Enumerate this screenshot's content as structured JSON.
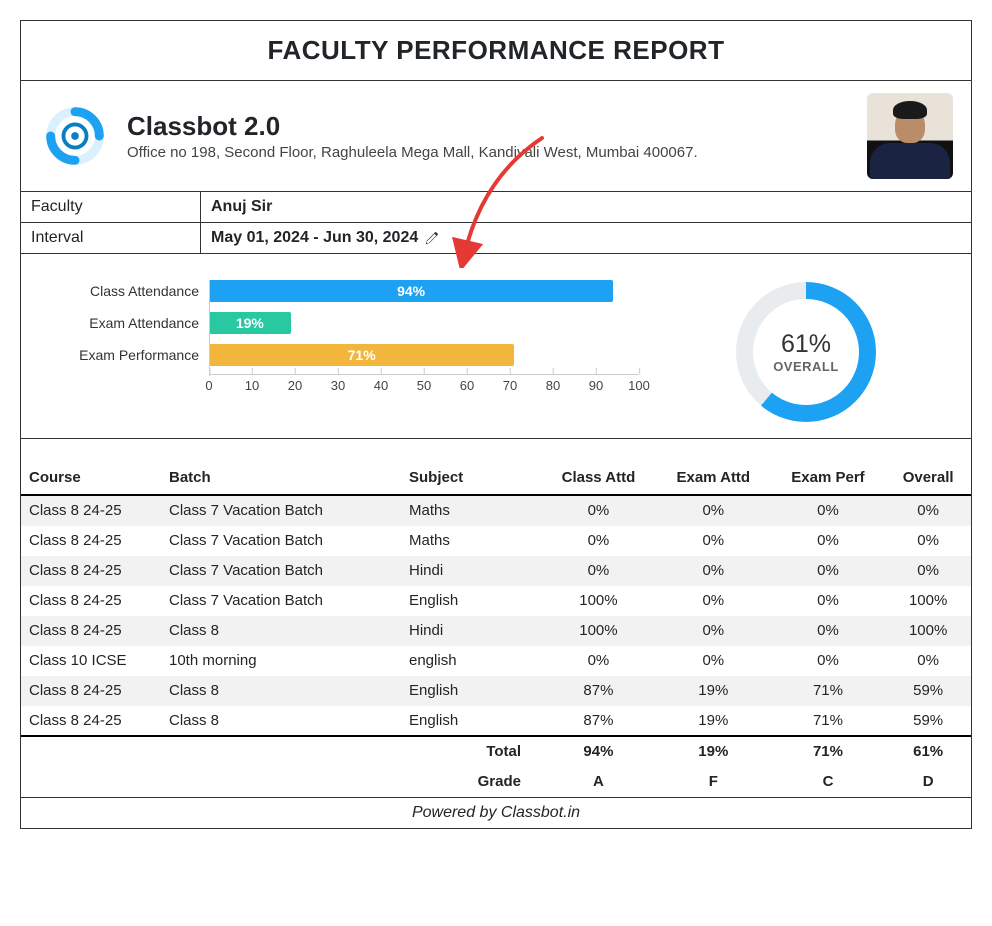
{
  "title": "FACULTY PERFORMANCE REPORT",
  "brand": {
    "name": "Classbot 2.0",
    "address": "Office no 198, Second Floor, Raghuleela Mega Mall, Kandivali West, Mumbai 400067."
  },
  "info": {
    "faculty_label": "Faculty",
    "faculty_value": "Anuj Sir",
    "interval_label": "Interval",
    "interval_value": "May 01, 2024 - Jun 30, 2024"
  },
  "chart_data": {
    "type": "bar",
    "orientation": "horizontal",
    "categories": [
      "Class Attendance",
      "Exam Attendance",
      "Exam Performance"
    ],
    "values": [
      94,
      19,
      71
    ],
    "value_labels": [
      "94%",
      "19%",
      "71%"
    ],
    "colors": [
      "#1da1f2",
      "#28c9a1",
      "#f2b63c"
    ],
    "xlim": [
      0,
      100
    ],
    "ticks": [
      0,
      10,
      20,
      30,
      40,
      50,
      60,
      70,
      80,
      90,
      100
    ],
    "donut": {
      "value": 61,
      "value_label": "61%",
      "label": "OVERALL",
      "fill_color": "#1da1f2",
      "track_color": "#e9ecef"
    }
  },
  "table": {
    "headers": {
      "course": "Course",
      "batch": "Batch",
      "subject": "Subject",
      "class_attd": "Class Attd",
      "exam_attd": "Exam Attd",
      "exam_perf": "Exam Perf",
      "overall": "Overall"
    },
    "rows": [
      {
        "course": "Class 8 24-25",
        "batch": "Class 7 Vacation Batch",
        "subject": "Maths",
        "class_attd": "0%",
        "exam_attd": "0%",
        "exam_perf": "0%",
        "overall": "0%"
      },
      {
        "course": "Class 8 24-25",
        "batch": "Class 7 Vacation Batch",
        "subject": "Maths",
        "class_attd": "0%",
        "exam_attd": "0%",
        "exam_perf": "0%",
        "overall": "0%"
      },
      {
        "course": "Class 8 24-25",
        "batch": "Class 7 Vacation Batch",
        "subject": "Hindi",
        "class_attd": "0%",
        "exam_attd": "0%",
        "exam_perf": "0%",
        "overall": "0%"
      },
      {
        "course": "Class 8 24-25",
        "batch": "Class 7 Vacation Batch",
        "subject": "English",
        "class_attd": "100%",
        "exam_attd": "0%",
        "exam_perf": "0%",
        "overall": "100%"
      },
      {
        "course": "Class 8 24-25",
        "batch": "Class 8",
        "subject": "Hindi",
        "class_attd": "100%",
        "exam_attd": "0%",
        "exam_perf": "0%",
        "overall": "100%"
      },
      {
        "course": "Class 10 ICSE",
        "batch": "10th morning",
        "subject": "english",
        "class_attd": "0%",
        "exam_attd": "0%",
        "exam_perf": "0%",
        "overall": "0%"
      },
      {
        "course": "Class 8 24-25",
        "batch": "Class 8",
        "subject": "English",
        "class_attd": "87%",
        "exam_attd": "19%",
        "exam_perf": "71%",
        "overall": "59%"
      },
      {
        "course": "Class 8 24-25",
        "batch": "Class 8",
        "subject": "English",
        "class_attd": "87%",
        "exam_attd": "19%",
        "exam_perf": "71%",
        "overall": "59%"
      }
    ],
    "totals": {
      "label": "Total",
      "class_attd": "94%",
      "exam_attd": "19%",
      "exam_perf": "71%",
      "overall": "61%"
    },
    "grades": {
      "label": "Grade",
      "class_attd": "A",
      "exam_attd": "F",
      "exam_perf": "C",
      "overall": "D"
    }
  },
  "footer": "Powered by Classbot.in"
}
